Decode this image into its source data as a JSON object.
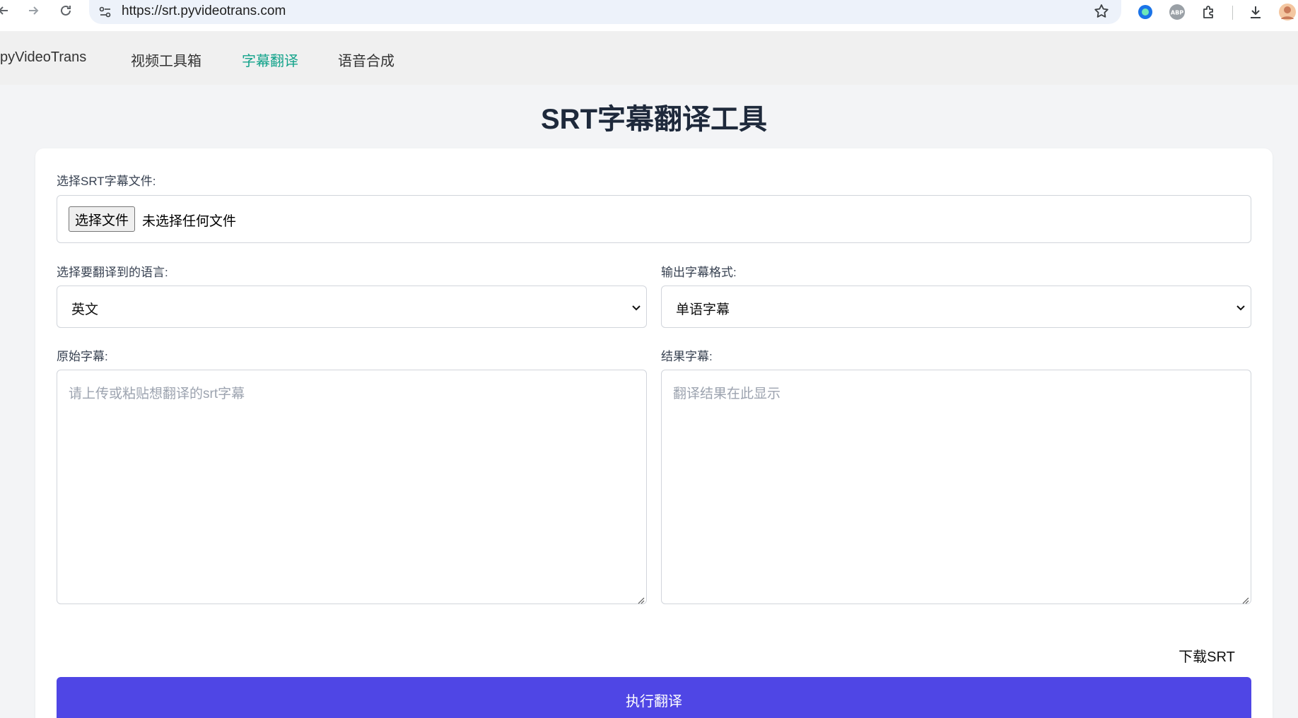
{
  "browser": {
    "url": "https://srt.pyvideotrans.com",
    "icons": [
      "back-arrow-icon",
      "forward-arrow-icon",
      "reload-icon",
      "site-settings-icon",
      "bookmark-star-icon",
      "extension-blue-dot-icon",
      "adblock-abp-icon",
      "extensions-puzzle-icon",
      "download-icon",
      "profile-avatar-icon"
    ],
    "abp_label": "ABP"
  },
  "nav": {
    "items": [
      {
        "label": "pyVideoTrans",
        "active": false
      },
      {
        "label": "视频工具箱",
        "active": false
      },
      {
        "label": "字幕翻译",
        "active": true
      },
      {
        "label": "语音合成",
        "active": false
      }
    ]
  },
  "page": {
    "title": "SRT字幕翻译工具"
  },
  "form": {
    "file_label": "选择SRT字幕文件:",
    "file_button": "选择文件",
    "file_status": "未选择任何文件",
    "lang_label": "选择要翻译到的语言:",
    "lang_value": "英文",
    "format_label": "输出字幕格式:",
    "format_value": "单语字幕",
    "source_label": "原始字幕:",
    "source_placeholder": "请上传或粘贴想翻译的srt字幕",
    "result_label": "结果字幕:",
    "result_placeholder": "翻译结果在此显示",
    "download_label": "下载SRT",
    "run_label": "执行翻译"
  },
  "colors": {
    "accent": "#4f46e5",
    "nav_active": "#14a38b",
    "title": "#1e293b"
  }
}
